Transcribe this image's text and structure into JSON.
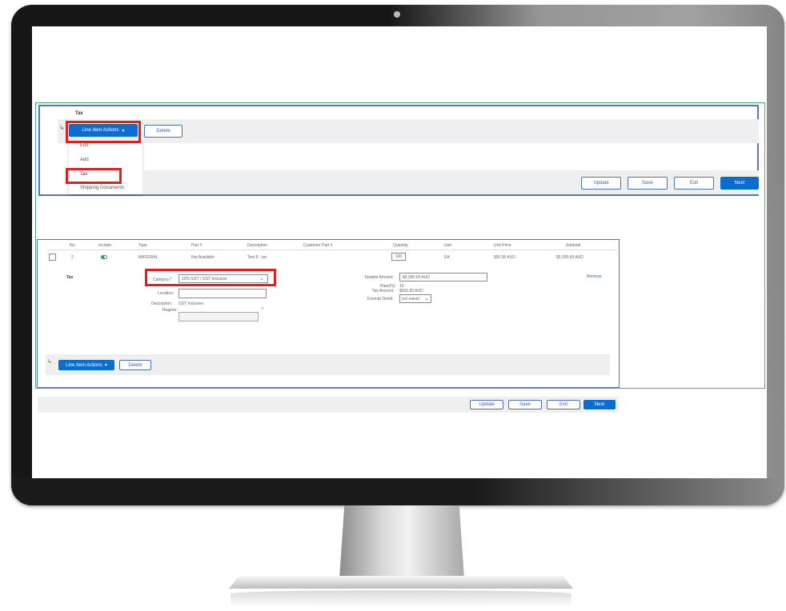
{
  "top_panel": {
    "section_title": "Tax",
    "line_item_actions": "Line Item Actions",
    "delete": "Delete",
    "menu": [
      "Edit",
      "Add",
      "Tax",
      "Shipping Documents"
    ],
    "buttons": {
      "update": "Update",
      "save": "Save",
      "exit": "Exit",
      "next": "Next"
    }
  },
  "bottom_panel": {
    "columns": [
      "No.",
      "Include",
      "Type",
      "Part #",
      "Description",
      "Customer Part #",
      "Quantity",
      "Unit",
      "Unit Price",
      "Subtotal"
    ],
    "row": {
      "no": "2",
      "type": "MATERIAL",
      "part": "Not Available",
      "description": "Test 8 - tax",
      "customer_part": "",
      "quantity": "100",
      "unit": "EA",
      "unit_price": "$50.00 AUD",
      "subtotal": "$5,000.00 AUD"
    },
    "tax": {
      "section_label": "Tax",
      "category_label": "Category:*",
      "category_value": "10% GST / GST Inclusive",
      "location_label": "Location:",
      "location_value": "",
      "description_label": "Description:",
      "description_value": "GST Inclusive",
      "regime_label": "Regime:",
      "taxable_amount_label": "Taxable Amount:",
      "taxable_amount_value": "$5,000.00 AUD",
      "rate_label": "Rate(%):",
      "rate_value": "10",
      "tax_amount_label": "Tax Amount:",
      "tax_amount_value": "$500.00 AUD",
      "exempt_detail_label": "Exempt Detail:",
      "exempt_detail_value": "(no value)",
      "remove": "Remove"
    },
    "line_item_actions": "Line Item Actions",
    "delete": "Delete",
    "buttons": {
      "update": "Update",
      "save": "Save",
      "exit": "Exit",
      "next": "Next"
    }
  },
  "colors": {
    "highlight_red": "#e02020",
    "primary_blue": "#0a6ed1",
    "frame_green": "#3fb27f",
    "panel_border": "#5b73b0"
  },
  "icons": {
    "indent_arrow": "↳",
    "dropdown_caret": "▾",
    "select_chevron": "⌄"
  }
}
